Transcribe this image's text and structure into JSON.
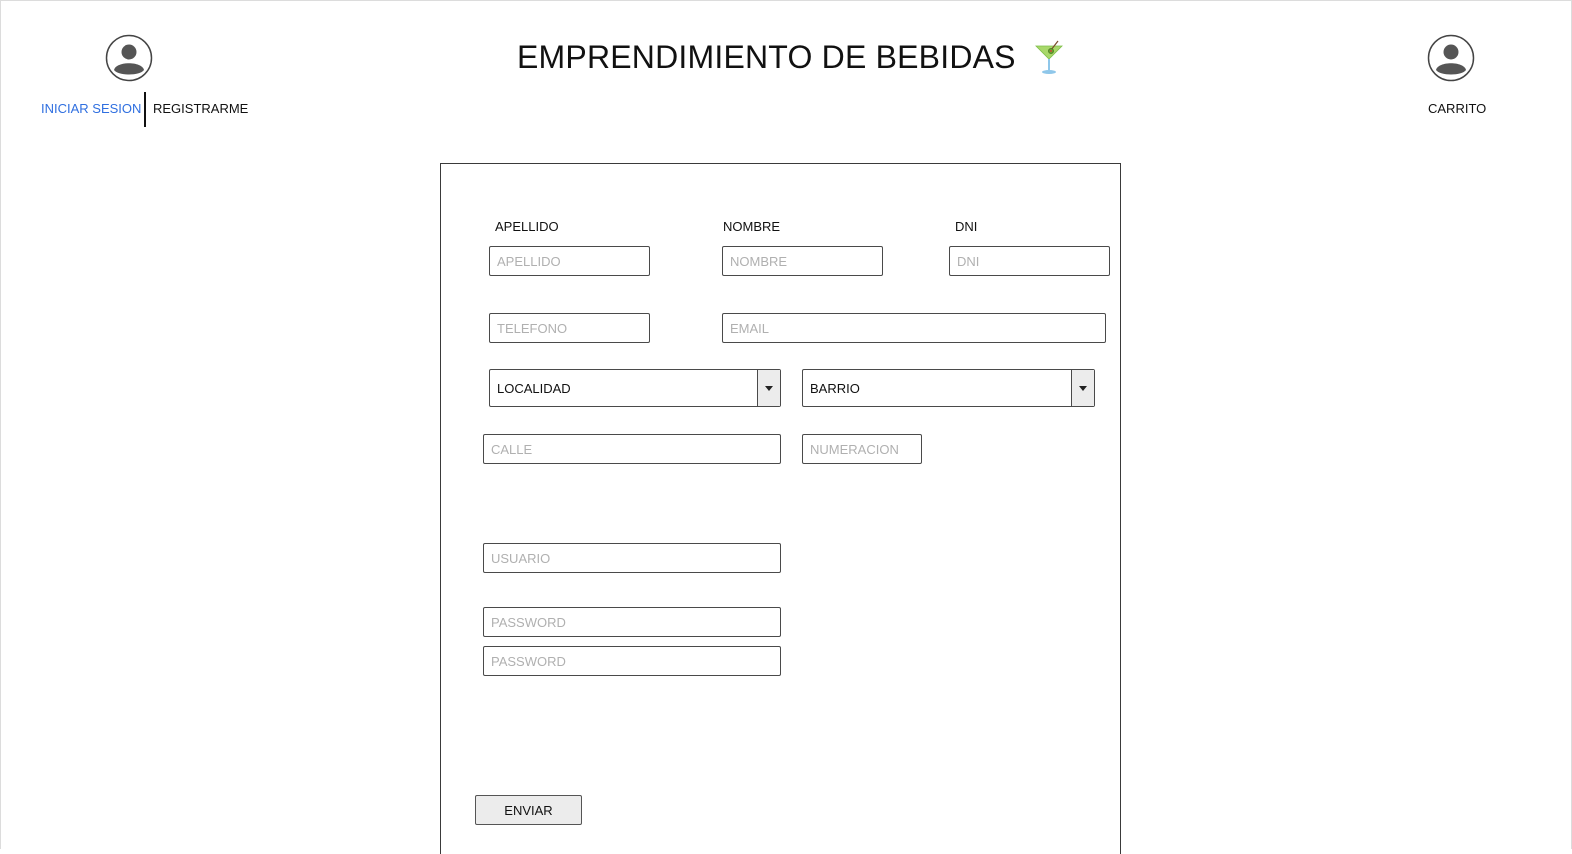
{
  "header": {
    "title": "EMPRENDIMIENTO DE BEBIDAS",
    "login_label": "INICIAR SESION",
    "register_label": "REGISTRARME",
    "cart_label": "CARRITO",
    "title_icon": "cocktail-icon",
    "user_icon": "user-avatar-icon",
    "login_color": "#2f6fe0"
  },
  "form": {
    "labels": {
      "apellido": "APELLIDO",
      "nombre": "NOMBRE",
      "dni": "DNI"
    },
    "placeholders": {
      "apellido": "APELLIDO",
      "nombre": "NOMBRE",
      "dni": "DNI",
      "telefono": "TELEFONO",
      "email": "EMAIL",
      "calle": "CALLE",
      "numeracion": "NUMERACION",
      "usuario": "USUARIO",
      "password": "PASSWORD",
      "password_confirm": "PASSWORD"
    },
    "values": {
      "apellido": "",
      "nombre": "",
      "dni": "",
      "telefono": "",
      "email": "",
      "calle": "",
      "numeracion": "",
      "usuario": "",
      "password": "",
      "password_confirm": ""
    },
    "selects": {
      "localidad": "LOCALIDAD",
      "barrio": "BARRIO"
    },
    "submit_label": "ENVIAR"
  }
}
